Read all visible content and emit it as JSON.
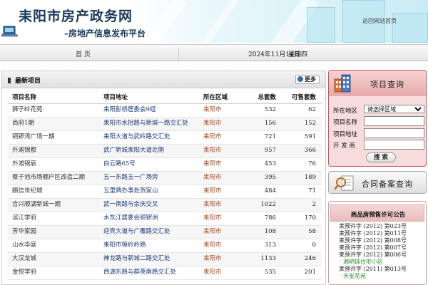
{
  "header": {
    "site_title": "耒阳市房产政务网",
    "site_subtitle": "–房地产信息发布平台",
    "return_link": "返回网站首页"
  },
  "navbar": {
    "home": "首 页",
    "date": "2024年11月14日",
    "weekday": "星期四"
  },
  "main": {
    "section_title": "最新项目",
    "more_label": "更多",
    "columns": [
      "项目名称",
      "项目地址",
      "所在区域",
      "总套数",
      "可售套数"
    ],
    "rows": [
      {
        "name": "狮子岭花苑·",
        "address": "耒阳彭桥居委会9组",
        "area": "耒阳市",
        "total": "532",
        "available": "62"
      },
      {
        "name": "尚府1期",
        "address": "耒阳市水抬路与新城一路交汇处",
        "area": "耒阳市",
        "total": "156",
        "available": "152"
      },
      {
        "name": "铜锣湾广场一期",
        "address": "耒阳大道与武岭路交汇处",
        "area": "耒阳市",
        "total": "721",
        "available": "591"
      },
      {
        "name": "外滩锦都",
        "address": "武广新城耒阳大道北侧",
        "area": "耒阳市",
        "total": "957",
        "available": "366"
      },
      {
        "name": "外滩锦宸",
        "address": "白云路65号",
        "area": "耒阳市",
        "total": "453",
        "available": "76"
      },
      {
        "name": "蔡子池市场棚户区改造二期",
        "address": "五一东路五一广场旁",
        "area": "耒阳市",
        "total": "395",
        "available": "189"
      },
      {
        "name": "鹏信世纪城",
        "address": "五里牌办事处贺家山",
        "area": "耒阳市",
        "total": "484",
        "available": "71"
      },
      {
        "name": "合兴顺湖新城一期",
        "address": "武一南路与余庆交叉",
        "area": "耒阳市",
        "total": "1022",
        "available": "2"
      },
      {
        "name": "滨江学府",
        "address": "水东江居委会铜锣洲",
        "area": "耒阳市",
        "total": "786",
        "available": "170"
      },
      {
        "name": "芳华家园",
        "address": "迎宾大道与广覆路交汇处",
        "area": "耒阳市",
        "total": "108",
        "available": "58"
      },
      {
        "name": "山水华庭",
        "address": "耒阳市樟岭岭路",
        "area": "耒阳市",
        "total": "313",
        "available": "0"
      },
      {
        "name": "大汉龙城",
        "address": "神龙路与新城二路交汇处",
        "area": "耒阳市",
        "total": "1133",
        "available": "246"
      },
      {
        "name": "金悦学府",
        "address": "西湖东路与群英南路交汇处",
        "area": "耒阳市",
        "total": "535",
        "available": "201"
      }
    ]
  },
  "query": {
    "title": "项目查询",
    "region_label": "所在地区",
    "region_selected": "请选择区域",
    "name_label": "项目名称",
    "address_label": "项目地址",
    "developer_label": "开 发 商",
    "search_label": "搜 索"
  },
  "contract": {
    "title": "合同备案查询"
  },
  "permits": {
    "title": "商品房预售许可公告",
    "items": [
      {
        "text": "耒预许字 (2012) 第023号",
        "sub": false
      },
      {
        "text": "耒预许字 (2012) 第011号",
        "sub": false
      },
      {
        "text": "耒预许字 (2012) 第008号",
        "sub": false
      },
      {
        "text": "耒预许字 (2012) 第007号",
        "sub": false
      },
      {
        "text": "耒预许字 (2012) 第006号",
        "sub": false
      },
      {
        "text": "湘明珠住宅小区",
        "sub": true
      },
      {
        "text": "耒预许字 (2011) 第013号",
        "sub": false
      },
      {
        "text": "天安花苑",
        "sub": true
      }
    ]
  },
  "colors": {
    "accent_blue": "#1a3a5a",
    "area_orange": "#b05020",
    "query_pink": "#f7dcdc",
    "permit_green": "#2a8a2a"
  }
}
